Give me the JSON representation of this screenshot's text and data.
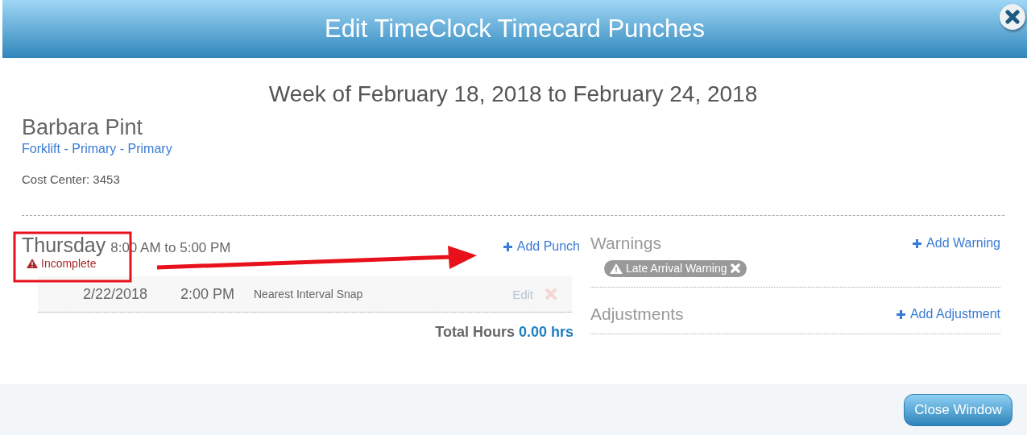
{
  "window": {
    "title": "Edit TimeClock Timecard Punches"
  },
  "week": "Week of February 18, 2018 to February 24, 2018",
  "employee": {
    "name": "Barbara Pint",
    "position": "Forklift - Primary - Primary",
    "cost_center": "Cost Center: 3453"
  },
  "day": {
    "name": "Thursday",
    "shift": "8:00 AM to 5:00 PM",
    "status": "Incomplete",
    "add_punch": "Add Punch",
    "total_label": "Total Hours",
    "total_value": "0.00 hrs",
    "punches": [
      {
        "date": "2/22/2018",
        "time": "2:00 PM",
        "rule": "Nearest Interval Snap",
        "edit": "Edit",
        "disabled": true
      }
    ]
  },
  "warnings": {
    "title": "Warnings",
    "add": "Add Warning",
    "tags": [
      "Late Arrival Warning"
    ]
  },
  "adjustments": {
    "title": "Adjustments",
    "add": "Add Adjustment"
  },
  "buttons": [
    "Close Window"
  ]
}
